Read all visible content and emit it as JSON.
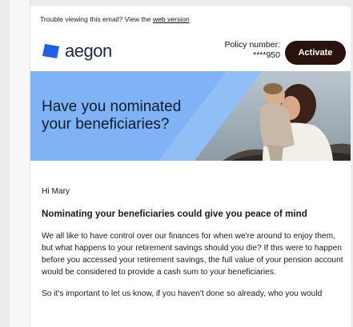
{
  "email": {
    "preheader": {
      "text": "Trouble viewing this email? View the ",
      "link": "web version"
    },
    "logo": {
      "text": "aegon",
      "mark_color": "#1f5fe6"
    },
    "policy": {
      "label": "Policy number:",
      "value": "****950"
    },
    "activate_label": "Activate",
    "hero": {
      "line1": "Have you nominated",
      "line2": "your beneficiaries?",
      "bg_color": "#7fb3f5"
    },
    "greeting": "Hi Mary",
    "subhead": "Nominating your beneficiaries could give you peace of mind",
    "para1": "We all like to have control over our finances for when we're around to enjoy them, but what happens to your retirement savings should you die? If this were to happen before you accessed your retirement savings, the full value of your pension account would be considered to provide a cash sum to your beneficiaries.",
    "para2": "So it's important to let us know, if you haven't done so already, who you would"
  }
}
